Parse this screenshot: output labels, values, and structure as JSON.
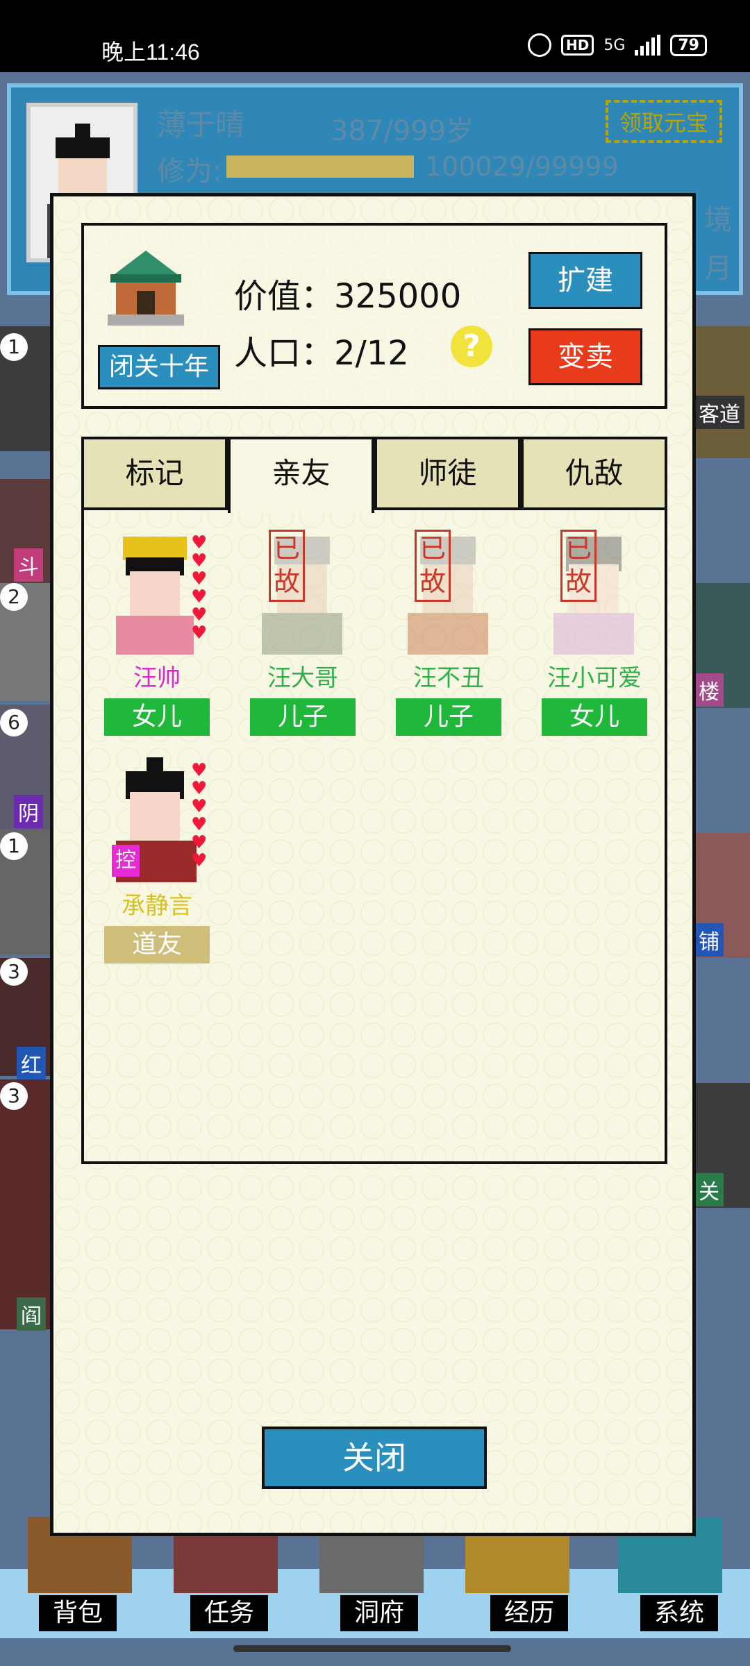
{
  "status_bar": {
    "time": "晚上11:46",
    "network": "5G",
    "hd": "HD",
    "battery": "79"
  },
  "background": {
    "name": "薄于晴",
    "age": "387/999岁",
    "claim_button": "领取元宝",
    "cultivation_label": "修为:",
    "cultivation_value": "100029/99999",
    "realm_suffix": "境",
    "month_suffix": "月",
    "side_tiles": [
      {
        "num": "1",
        "tag": ""
      },
      {
        "num": "",
        "tag": "斗"
      },
      {
        "num": "2",
        "tag": ""
      },
      {
        "num": "6",
        "tag": "阴"
      },
      {
        "num": "1",
        "tag": ""
      },
      {
        "num": "3",
        "tag": "红"
      },
      {
        "num": "3",
        "tag": "阎"
      }
    ],
    "right_tags": [
      "客道",
      "境",
      "楼",
      "铺",
      "关"
    ]
  },
  "bottom_nav": [
    {
      "label": "背包"
    },
    {
      "label": "任务"
    },
    {
      "label": "洞府"
    },
    {
      "label": "经历"
    },
    {
      "label": "系统"
    }
  ],
  "modal": {
    "seal_button": "闭关十年",
    "value_label": "价值：325000",
    "population_label": "人口：2/12",
    "help_icon": "?",
    "expand_button": "扩建",
    "sell_button": "变卖",
    "tabs": [
      {
        "label": "标记",
        "active": false
      },
      {
        "label": "亲友",
        "active": true
      },
      {
        "label": "师徒",
        "active": false
      },
      {
        "label": "仇敌",
        "active": false
      }
    ],
    "dead_stamp": "已故",
    "control_badge": "控",
    "members": [
      {
        "name": "汪帅",
        "relation": "女儿",
        "name_color": "#d92ad0",
        "relation_color": "#1fb83a",
        "dead": false,
        "hearts": 6,
        "controlled": false
      },
      {
        "name": "汪大哥",
        "relation": "儿子",
        "name_color": "#2fb04a",
        "relation_color": "#1fb83a",
        "dead": true,
        "hearts": 0,
        "controlled": false
      },
      {
        "name": "汪不丑",
        "relation": "儿子",
        "name_color": "#2fb04a",
        "relation_color": "#1fb83a",
        "dead": true,
        "hearts": 0,
        "controlled": false
      },
      {
        "name": "汪小可爱",
        "relation": "女儿",
        "name_color": "#2fb04a",
        "relation_color": "#1fb83a",
        "dead": true,
        "hearts": 0,
        "controlled": false
      },
      {
        "name": "承静言",
        "relation": "道友",
        "name_color": "#d6c21f",
        "relation_color": "#cfbd7a",
        "dead": false,
        "hearts": 6,
        "controlled": true
      }
    ],
    "close_button": "关闭"
  },
  "colors": {
    "modal_bg": "#f7f7e4",
    "accent_blue": "#2b8fbd",
    "accent_red": "#e83b1c",
    "tab_bg": "#e5e2b8"
  }
}
